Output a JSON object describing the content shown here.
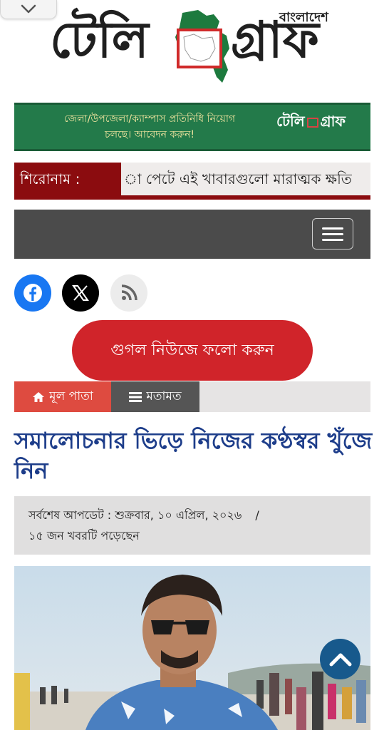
{
  "logo": {
    "left_text": "টেলি",
    "right_text": "গ্রাফ",
    "subtitle": "বাংলাদেশ"
  },
  "ad_banner": {
    "line1": "জেলা/উপজেলা/ক্যাম্পাস প্রতিনিধি নিয়োগ",
    "line2": "চলছে। আবেদন করুন!",
    "brand_left": "টেলি",
    "brand_right": "গ্রাফ"
  },
  "ticker": {
    "label": "শিরোনাম :",
    "text": "া পেটে এই খাবারগুলো মারাত্মক ক্ষতি"
  },
  "social": {
    "icons": [
      "facebook-icon",
      "x-icon",
      "rss-icon"
    ]
  },
  "google_news_button": {
    "label": "গুগল নিউজে ফলো করুন"
  },
  "breadcrumb": {
    "home": "মূল পাতা",
    "category": "মতামত"
  },
  "article": {
    "title": "সমালোচনার ভিড়ে নিজের কণ্ঠস্বর খুঁজে নিন",
    "updated": "সর্বশেষ আপডেট : শুক্রবার, ১০ এপ্রিল, ২০২৬",
    "separator": "/",
    "readers": "১৫ জন খবরটি পড়েছেন"
  },
  "colors": {
    "ad_green": "#237a4a",
    "ticker_red": "#8b0c0f",
    "nav_gray": "#4b4b4b",
    "button_red": "#d0242a",
    "crumb_home": "#de4b40",
    "crumb_cat": "#555555",
    "title_blue": "#1d3d8a",
    "scroll_blue": "#17598c"
  }
}
